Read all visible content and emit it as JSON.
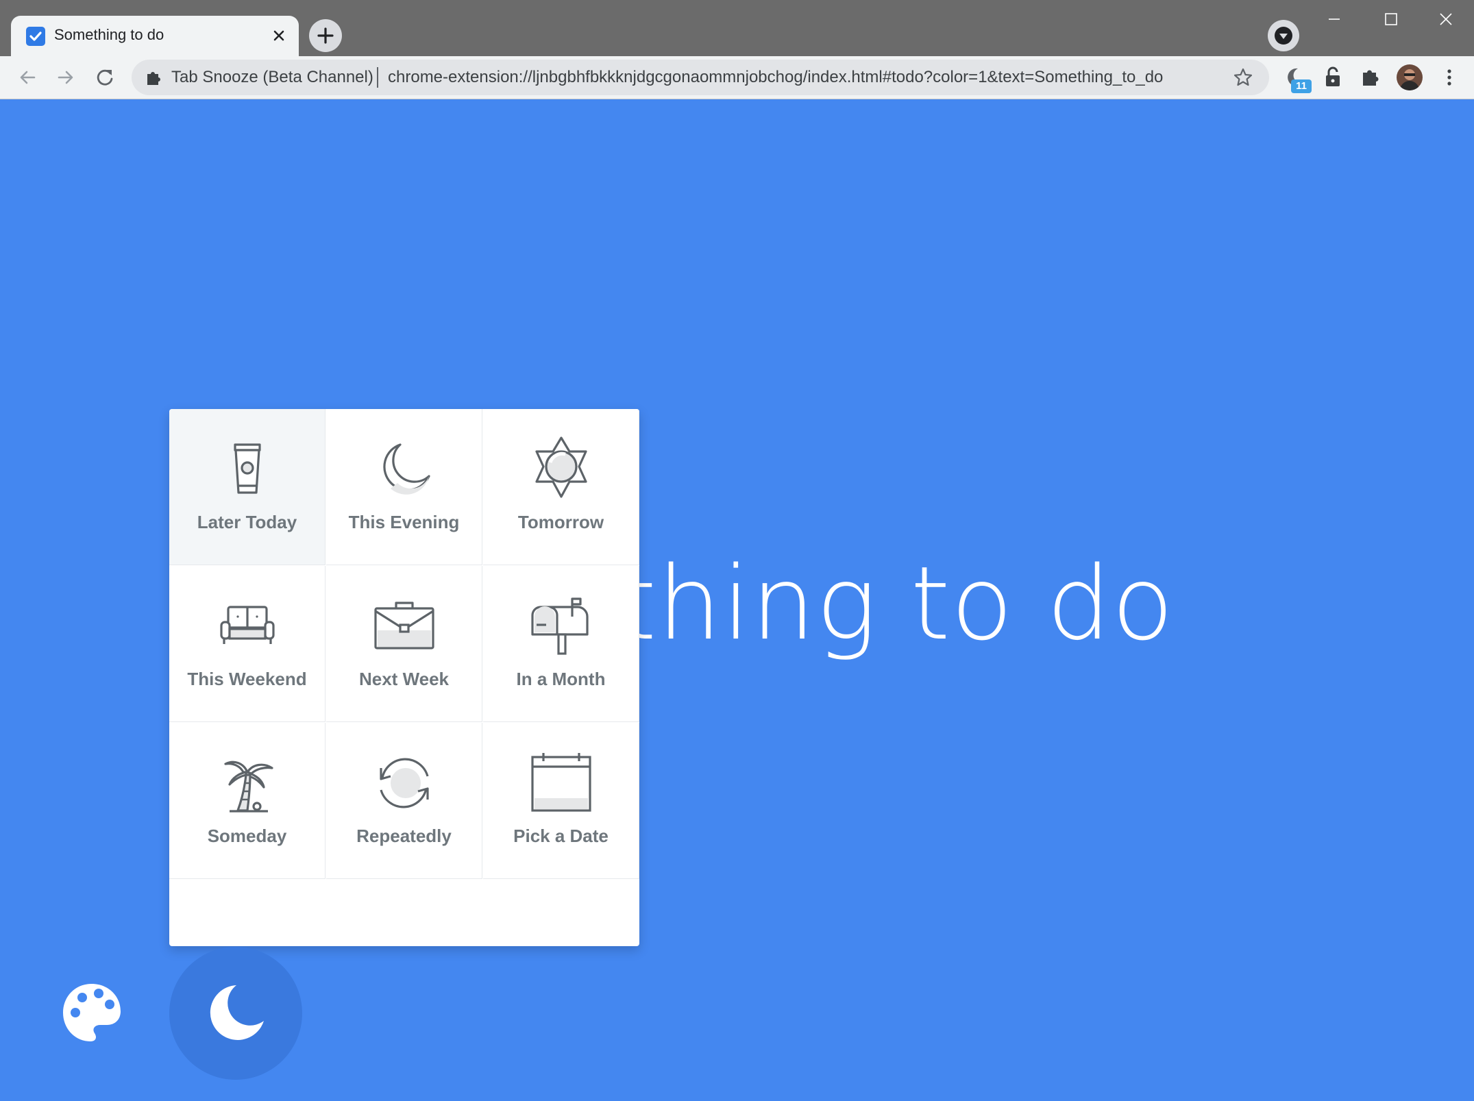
{
  "browser": {
    "tab_title": "Something to do",
    "omnibox_site": "Tab Snooze (Beta Channel)",
    "omnibox_url": "chrome-extension://ljnbgbhfbkkknjdgcgonaommnjobchog/index.html#todo?color=1&text=Something_to_do",
    "extension_badge": "11"
  },
  "page": {
    "background_color": "#4487f0",
    "todo_text_visible": "thing to do"
  },
  "snooze_panel": {
    "options": [
      {
        "label": "Later Today",
        "icon": "coffee-cup-icon",
        "selected": true
      },
      {
        "label": "This Evening",
        "icon": "moon-icon"
      },
      {
        "label": "Tomorrow",
        "icon": "sun-icon"
      },
      {
        "label": "This Weekend",
        "icon": "couch-icon"
      },
      {
        "label": "Next Week",
        "icon": "briefcase-icon"
      },
      {
        "label": "In a Month",
        "icon": "mailbox-icon"
      },
      {
        "label": "Someday",
        "icon": "palm-tree-icon"
      },
      {
        "label": "Repeatedly",
        "icon": "repeat-icon"
      },
      {
        "label": "Pick a Date",
        "icon": "calendar-icon"
      }
    ]
  },
  "bottom_bar": {
    "palette_icon": "palette-icon",
    "snooze_icon": "moon-icon"
  }
}
